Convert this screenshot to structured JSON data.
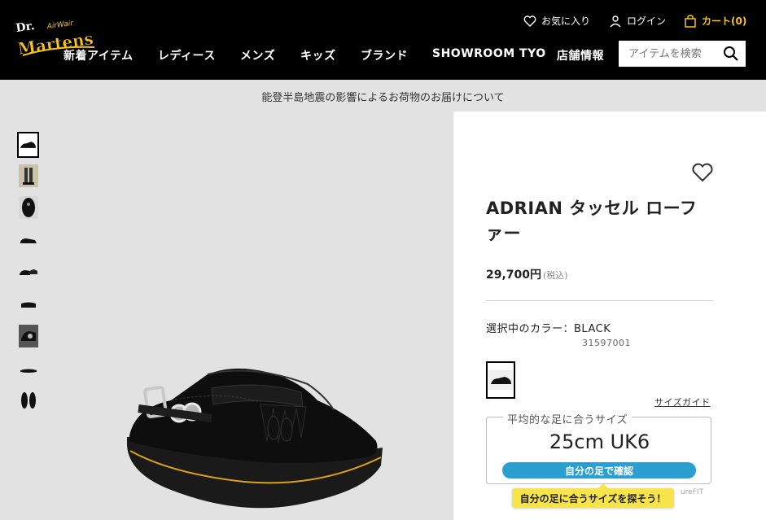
{
  "header": {
    "brand": "Dr. Martens AirWair",
    "utility": {
      "favorites": "お気に入り",
      "login": "ログイン",
      "cart": "カート(0)"
    },
    "nav": [
      "新着アイテム",
      "レディース",
      "メンズ",
      "キッズ",
      "ブランド",
      "SHOWROOM TYO",
      "店舗情報"
    ],
    "search_placeholder": "アイテムを検索"
  },
  "notice": "能登半島地震の影響によるお荷物のお届けについて",
  "gallery": {
    "thumbnails": [
      "loafer-side",
      "model-legs",
      "loafer-top",
      "loafer-pair-side",
      "loafer-pair-angle",
      "loafer-back",
      "loafer-detail",
      "loafer-sole",
      "loafer-front-pair"
    ],
    "selected_index": 0
  },
  "product": {
    "title": "ADRIAN タッセル ローファー",
    "price": "29,700円",
    "tax_note": "(税込)",
    "color_label": "選択中のカラー：BLACK",
    "sku": "31597001",
    "size_guide": "サイズガイド",
    "fit": {
      "heading": "平均的な足に合うサイズ",
      "size": "25cm UK6",
      "button": "自分の足で確認",
      "tip": "自分の足に合うサイズを探そう！",
      "brand": "ureFIT"
    }
  },
  "colors": {
    "header_bg": "#000000",
    "cart_accent": "#f5c518",
    "gallery_bg": "#e2e2e2",
    "fit_button": "#2a9fd0",
    "fit_tip": "#f7e34a"
  }
}
